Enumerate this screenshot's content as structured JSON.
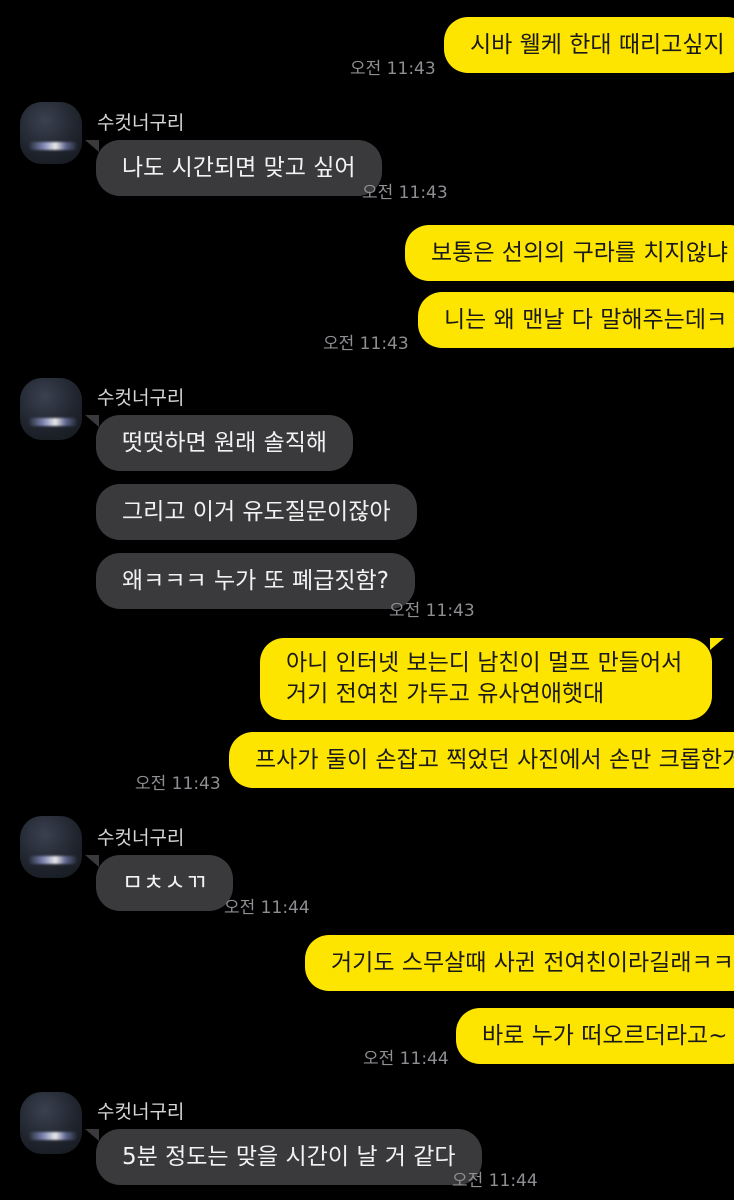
{
  "contact_name": "수컷너구리",
  "messages": [
    {
      "text": "시바 웰케 한대 때리고싶지",
      "time": "오전 11:43"
    },
    {
      "text": "나도 시간되면 맞고 싶어",
      "time": "오전 11:43"
    },
    {
      "text": "보통은 선의의 구라를 치지않냐"
    },
    {
      "text": "니는 왜 맨날 다 말해주는데ㅋ",
      "time": "오전 11:43"
    },
    {
      "text": "떳떳하면 원래 솔직해"
    },
    {
      "text": "그리고 이거 유도질문이잖아"
    },
    {
      "text": "왜ㅋㅋㅋ 누가 또 폐급짓함?",
      "time": "오전 11:43"
    },
    {
      "text": "아니 인터넷 보는디 남친이 멀프 만들어서 거기 전여친 가두고 유사연애햇대"
    },
    {
      "text": "프사가 둘이 손잡고 찍었던 사진에서 손만 크롭한거",
      "time": "오전 11:43"
    },
    {
      "text": "ㅁㅊㅅㄲ",
      "time": "오전 11:44"
    },
    {
      "text": "거기도 스무살때 사귄 전여친이라길래ㅋㅋ"
    },
    {
      "text": "바로 누가 떠오르더라고~",
      "time": "오전 11:44"
    },
    {
      "text": "5분 정도는 맞을 시간이 날 거 같다",
      "time": "오전 11:44"
    }
  ],
  "colors": {
    "background": "#000000",
    "my_bubble": "#fee500",
    "their_bubble": "#3a3a3c"
  }
}
